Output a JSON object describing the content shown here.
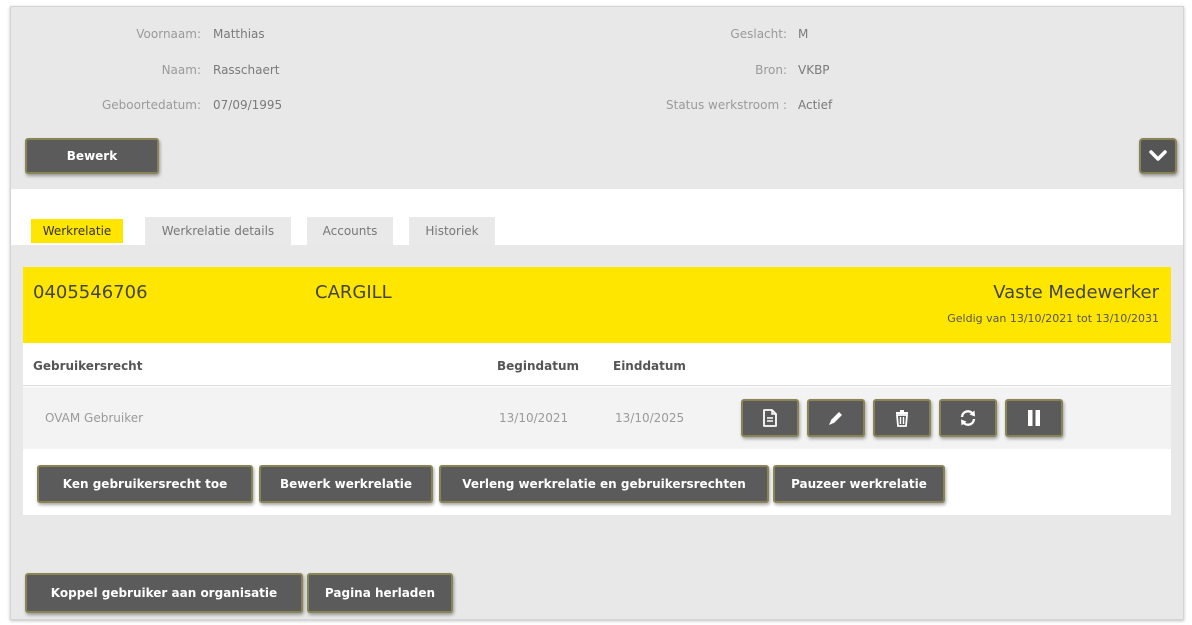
{
  "person": {
    "voornaam_label": "Voornaam:",
    "voornaam_value": "Matthias",
    "naam_label": "Naam:",
    "naam_value": "Rasschaert",
    "geboortedatum_label": "Geboortedatum:",
    "geboortedatum_value": "07/09/1995",
    "geslacht_label": "Geslacht:",
    "geslacht_value": "M",
    "bron_label": "Bron:",
    "bron_value": "VKBP",
    "status_label": "Status werkstroom :",
    "status_value": "Actief"
  },
  "actions": {
    "bewerk_label": "Bewerk",
    "expand_icon": "chevron-down-icon"
  },
  "tabs": [
    {
      "label": "Werkrelatie",
      "active": true
    },
    {
      "label": "Werkrelatie details",
      "active": false
    },
    {
      "label": "Accounts",
      "active": false
    },
    {
      "label": "Historiek",
      "active": false
    }
  ],
  "werkrelatie": {
    "ondernemingsnummer": "0405546706",
    "organisatie": "CARGILL",
    "rol": "Vaste Medewerker",
    "geldigheid": "Geldig van 13/10/2021 tot 13/10/2031",
    "columns": [
      "Gebruikersrecht",
      "Begindatum",
      "Einddatum"
    ],
    "rows": [
      {
        "gebruikersrecht": "OVAM Gebruiker",
        "begindatum": "13/10/2021",
        "einddatum": "13/10/2025",
        "row_actions": [
          "document-icon",
          "pencil-icon",
          "trash-icon",
          "refresh-icon",
          "pause-icon"
        ]
      }
    ],
    "buttons": {
      "ken_toe": "Ken gebruikersrecht toe",
      "bewerk": "Bewerk werkrelatie",
      "verleng": "Verleng werkrelatie en gebruikersrechten",
      "pauzeer": "Pauzeer werkrelatie"
    }
  },
  "footer": {
    "koppel_label": "Koppel gebruiker aan organisatie",
    "herladen_label": "Pagina herladen"
  },
  "colors": {
    "accent_yellow": "#ffe600",
    "button_dark": "#5b5b5b",
    "panel_grey": "#e8e8e8"
  }
}
